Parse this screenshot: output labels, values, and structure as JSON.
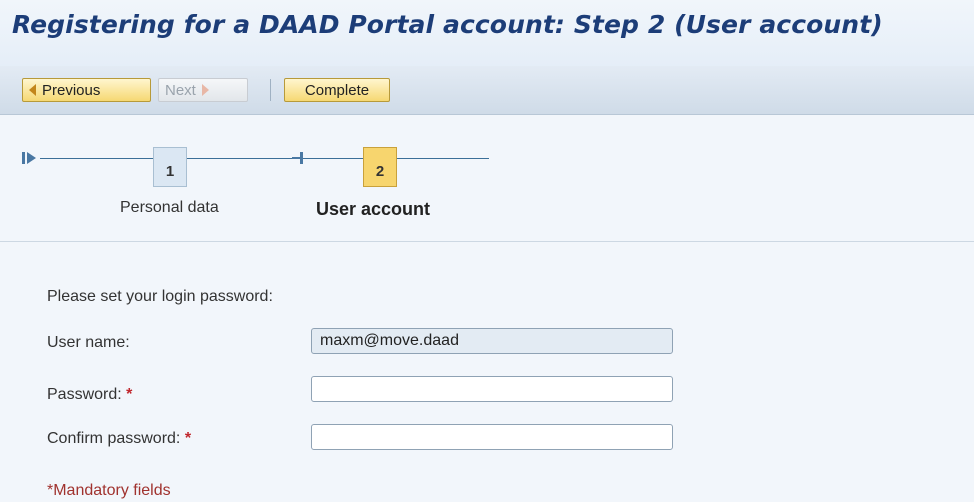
{
  "page": {
    "title": "Registering for a DAAD Portal account: Step 2 (User account)"
  },
  "toolbar": {
    "previous_label": "Previous",
    "next_label": "Next",
    "complete_label": "Complete"
  },
  "roadmap": {
    "steps": [
      {
        "number": "1",
        "label": "Personal data",
        "active": false
      },
      {
        "number": "2",
        "label": "User account",
        "active": true
      }
    ]
  },
  "form": {
    "instruction": "Please set your login password:",
    "username_label": "User name:",
    "username_value": "maxm@move.daad",
    "password_label": "Password:",
    "password_value": "",
    "confirm_label": "Confirm password:",
    "confirm_value": "",
    "required_marker": "*",
    "mandatory_note": "*Mandatory fields"
  },
  "colors": {
    "title": "#1c3d78",
    "button_fill": "#f6d873",
    "active_step": "#f7d56e",
    "inactive_step": "#dbe7f3",
    "required": "#c0272d"
  },
  "icons": {
    "previous": "arrow-left-icon",
    "next": "arrow-right-icon",
    "roadmap_start": "roadmap-start-icon",
    "roadmap_marker": "roadmap-step-marker-icon"
  }
}
